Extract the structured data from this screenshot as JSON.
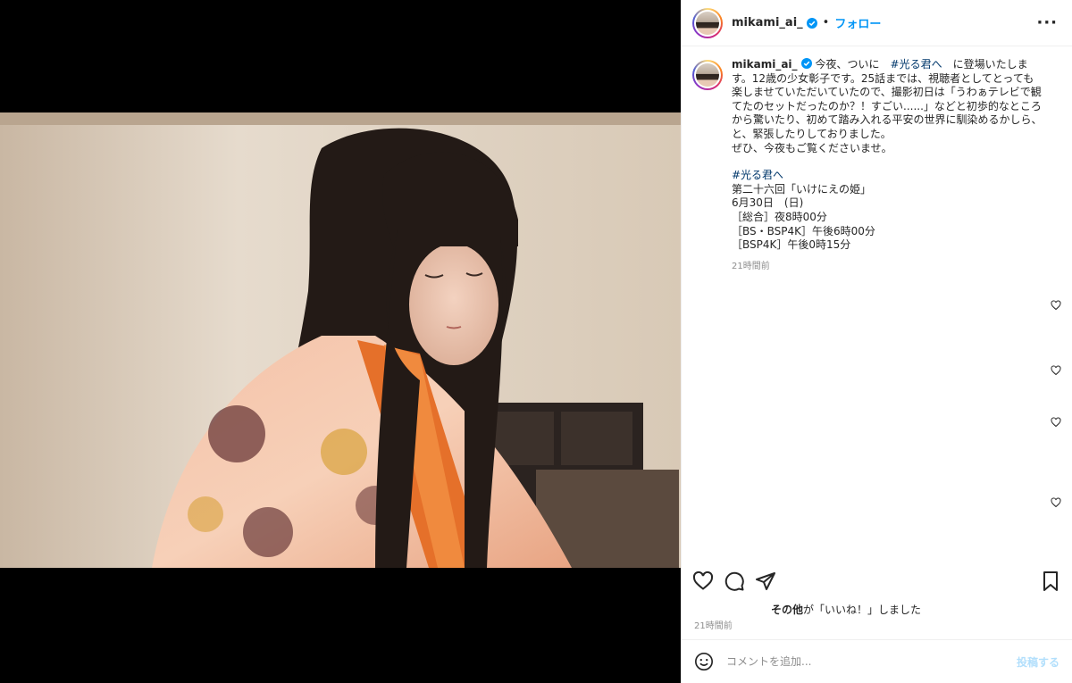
{
  "post": {
    "username": "mikami_ai_",
    "separator": "•",
    "follow_label": "フォロー",
    "more_label": "···",
    "caption": {
      "username": "mikami_ai_",
      "text_intro": "今夜、ついに　",
      "hashtag_1": "#光る君へ",
      "text_main": "　に登場いたします。12歳の少女彰子です。25話までは、視聴者としてとっても楽しませていただいていたので、撮影初日は「うわぁテレビで観てたのセットだったのか？！すごい......」などと初歩的なところから驚いたり、初めて踏み入れる平安の世界に馴染めるかしら、と、緊張したりしておりました。",
      "text_closing": "ぜひ、今夜もご覧くださいませ。",
      "hashtag_2": "#光る君へ",
      "line_episode": "第二十六回「いけにえの姫」",
      "line_date": "6月30日　(日)",
      "line_sogo": "［総合］夜8時00分",
      "line_bs": "［BS・BSP4K］午後6時00分",
      "line_bsp4k": "［BSP4K］午後0時15分",
      "time": "21時間前"
    },
    "likes_text_bold": "その他",
    "likes_text": "が「いいね！」しました",
    "post_time": "21時間前",
    "comment_placeholder": "コメントを追加...",
    "post_button": "投稿する"
  },
  "icons": {
    "like": "heart-icon",
    "comment": "comment-icon",
    "share": "paper-plane-icon",
    "save": "bookmark-icon",
    "emoji": "emoji-icon",
    "verified": "verified-badge-icon"
  },
  "colors": {
    "accent": "#0095f6",
    "hashtag": "#00376b",
    "muted": "#8e8e8e",
    "text": "#262626"
  }
}
